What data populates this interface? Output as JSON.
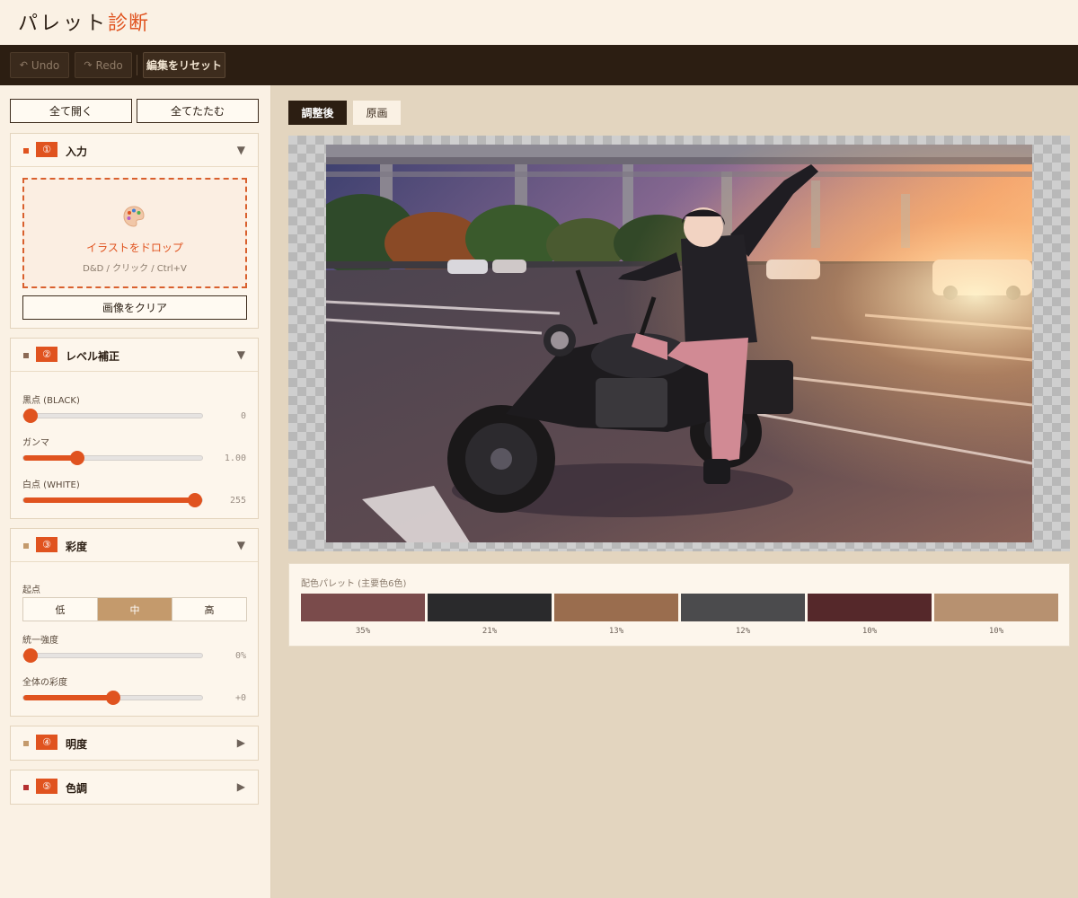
{
  "header": {
    "title_main": "パレット",
    "title_accent": "診断"
  },
  "toolbar": {
    "undo_label": "Undo",
    "redo_label": "Redo",
    "reset_label": "編集をリセット"
  },
  "sidebar": {
    "expand_all": "全て開く",
    "collapse_all": "全てたたむ",
    "panels": {
      "input": {
        "number": "①",
        "title": "入力",
        "dot_color": "#e0531f",
        "drop_label": "イラストをドロップ",
        "drop_hint": "D&D / クリック / Ctrl+V",
        "clear_label": "画像をクリア"
      },
      "levels": {
        "number": "②",
        "title": "レベル補正",
        "dot_color": "#8c6a55",
        "black": {
          "label": "黒点 (BLACK)",
          "display": "0",
          "fraction": 0.04
        },
        "gamma": {
          "label": "ガンマ",
          "display": "1.00",
          "fraction": 0.3
        },
        "white": {
          "label": "白点 (WHITE)",
          "display": "255",
          "fraction": 0.96
        }
      },
      "saturation": {
        "number": "③",
        "title": "彩度",
        "dot_color": "#c49a6c",
        "origin_label": "起点",
        "options": [
          "低",
          "中",
          "高"
        ],
        "selected": "中",
        "uniform": {
          "label": "統一強度",
          "display": "0%",
          "fraction": 0.04
        },
        "overall": {
          "label": "全体の彩度",
          "display": "+0",
          "fraction": 0.5
        }
      },
      "brightness": {
        "number": "④",
        "title": "明度",
        "dot_color": "#c49a6c"
      },
      "tone": {
        "number": "⑤",
        "title": "色調",
        "dot_color": "#b53030"
      }
    }
  },
  "view": {
    "tab_adjusted": "調整後",
    "tab_original": "原画"
  },
  "palette": {
    "title": "配色パレット (主要色6色)",
    "swatches": [
      {
        "color": "#7a4b4b",
        "percent": "35%"
      },
      {
        "color": "#2a2a2c",
        "percent": "21%"
      },
      {
        "color": "#9a6d4e",
        "percent": "13%"
      },
      {
        "color": "#4b4b4d",
        "percent": "12%"
      },
      {
        "color": "#55282a",
        "percent": "10%"
      },
      {
        "color": "#b79170",
        "percent": "10%"
      }
    ]
  }
}
